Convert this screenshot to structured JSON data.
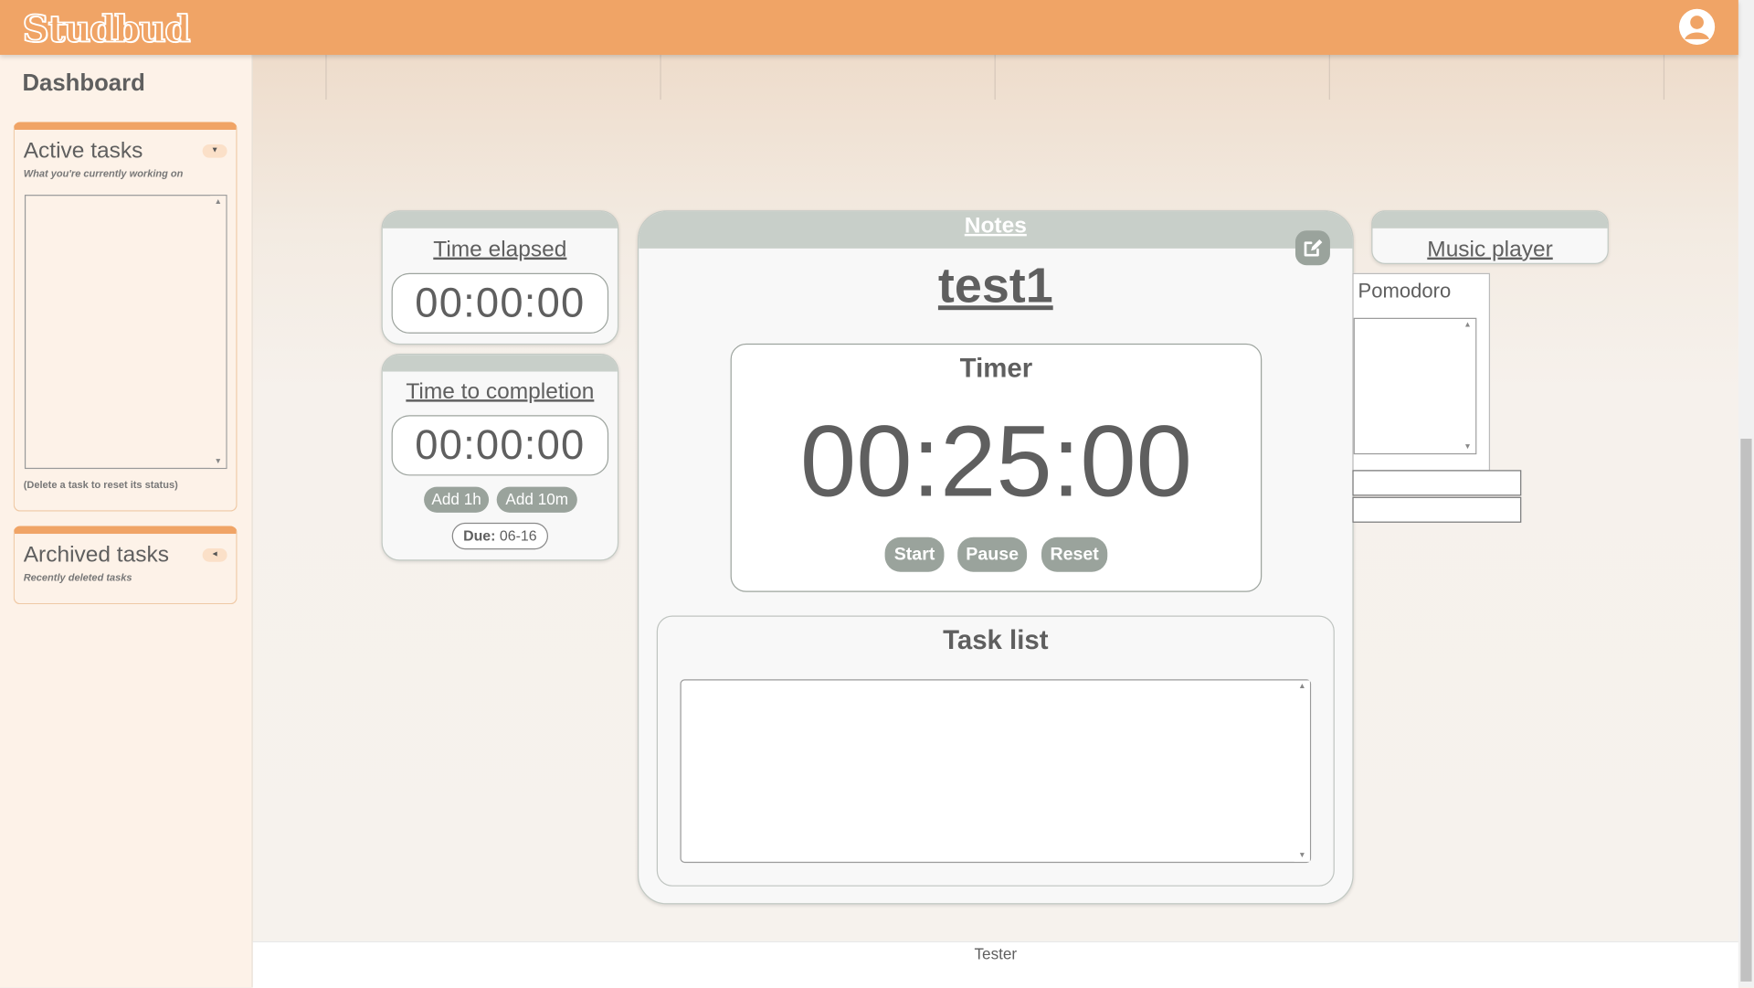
{
  "app": {
    "name": "Studbud"
  },
  "header": {
    "user_icon": "user-circle-icon"
  },
  "sidebar": {
    "title": "Dashboard",
    "active_tasks": {
      "title": "Active tasks",
      "subtitle": "What you're currently working on",
      "toggle": "▼",
      "note": "(Delete a task to reset its status)"
    },
    "archived_tasks": {
      "title": "Archived tasks",
      "subtitle": "Recently deleted tasks",
      "toggle": "◄"
    }
  },
  "time_elapsed": {
    "title": "Time elapsed",
    "value": "00:00:00"
  },
  "time_to_completion": {
    "title": "Time to completion",
    "value": "00:00:00",
    "add_1h": "Add 1h",
    "add_10m": "Add 10m",
    "due_label": "Due:",
    "due_value": "06-16"
  },
  "notes": {
    "title": "Notes",
    "doc_name": "test1",
    "edit_icon": "edit-icon",
    "timer": {
      "title": "Timer",
      "value": "00:25:00",
      "start": "Start",
      "pause": "Pause",
      "reset": "Reset"
    },
    "task_list": {
      "title": "Task list"
    }
  },
  "music_player": {
    "title": "Music player"
  },
  "pomodoro": {
    "title": "Pomodoro"
  },
  "footer": {
    "text": "Tester"
  },
  "colors": {
    "header": "#f0a466",
    "sidebar": "#fdf2e8",
    "button": "#9aa39c",
    "card_bar": "#c8cfc9"
  }
}
